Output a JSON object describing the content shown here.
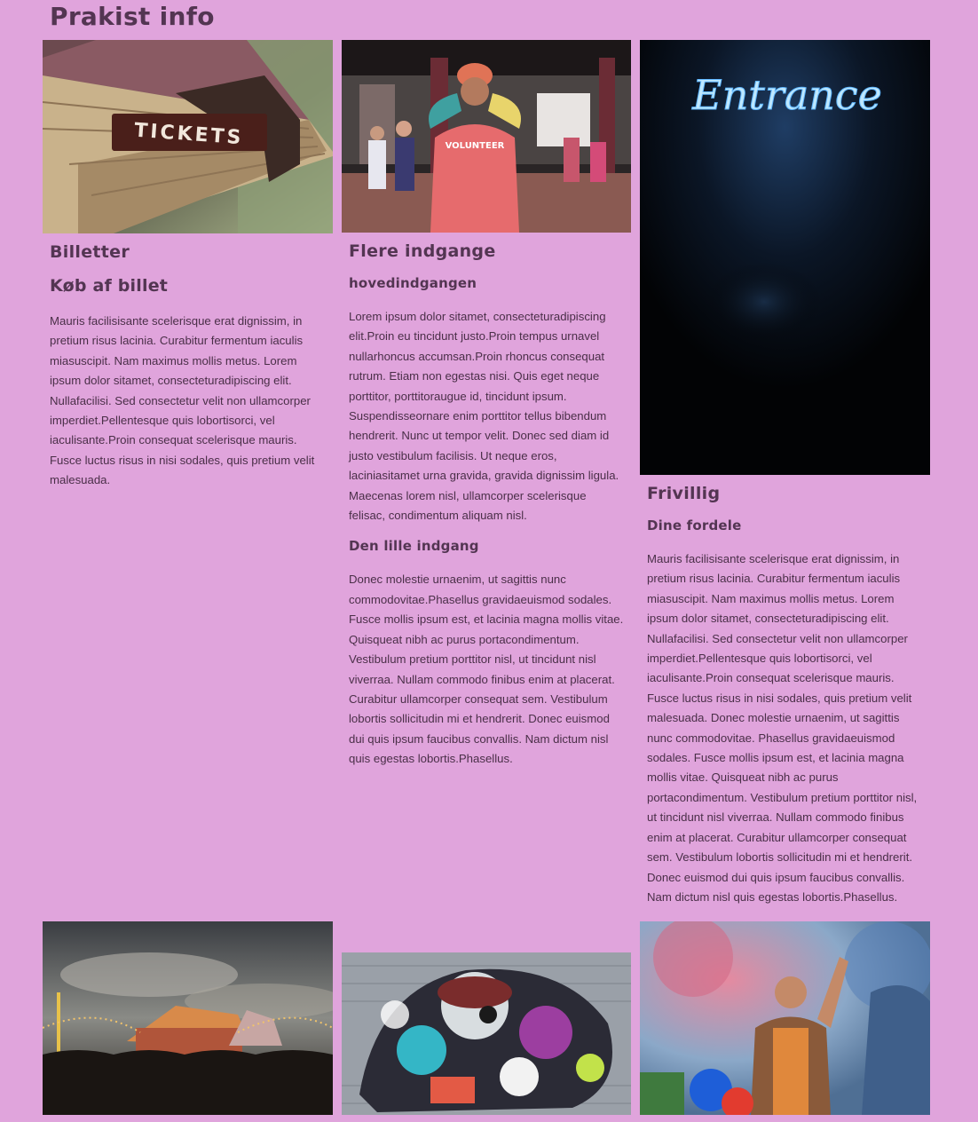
{
  "page": {
    "title": "Prakist info"
  },
  "columns": [
    {
      "image_alt": "tickets-sign-photo",
      "heading": "Billetter",
      "subheading": "Køb af billet",
      "body": "Mauris facilisisante scelerisque erat dignissim, in pretium risus lacinia. Curabitur fermentum iaculis miasuscipit. Nam maximus mollis metus. Lorem ipsum dolor sitamet, consecteturadipiscing elit. Nullafacilisi. Sed consectetur velit non ullamcorper imperdiet.Pellentesque quis lobortisorci, vel iaculisante.Proin consequat scelerisque mauris. Fusce luctus risus in nisi sodales, quis pretium velit malesuada."
    },
    {
      "image_alt": "volunteer-photo",
      "heading": "Flere indgange",
      "subheading": "hovedindgangen",
      "body": "Lorem ipsum dolor sitamet, consecteturadipiscing elit.Proin eu tincidunt justo.Proin tempus urnavel nullarhoncus accumsan.Proin rhoncus consequat rutrum. Etiam non egestas nisi. Quis eget neque porttitor, porttitoraugue id, tincidunt ipsum. Suspendisseornare enim porttitor tellus bibendum hendrerit. Nunc ut tempor velit. Donec sed diam id justo vestibulum facilisis. Ut neque eros, laciniasitamet urna gravida, gravida dignissim ligula. Maecenas lorem nisl, ullamcorper scelerisque felisac, condimentum aliquam nisl.",
      "subheading2": "Den lille indgang",
      "body2": "Donec molestie urnaenim, ut sagittis nunc commodovitae.Phasellus gravidaeuismod sodales. Fusce mollis ipsum est, et lacinia magna mollis vitae. Quisqueat nibh ac purus portacondimentum. Vestibulum pretium porttitor nisl, ut tincidunt nisl viverraa. Nullam commodo finibus enim at placerat. Curabitur ullamcorper consequat sem. Vestibulum lobortis sollicitudin mi et hendrerit. Donec euismod dui quis ipsum faucibus convallis. Nam dictum nisl quis egestas lobortis.Phasellus."
    },
    {
      "image_alt": "entrance-neon-photo",
      "neon_text": "Entrance",
      "heading": "Frivillig",
      "subheading": "Dine fordele",
      "body": "Mauris facilisisante scelerisque erat dignissim, in pretium risus lacinia. Curabitur fermentum iaculis miasuscipit. Nam maximus mollis metus. Lorem ipsum dolor sitamet, consecteturadipiscing elit. Nullafacilisi. Sed consectetur velit non ullamcorper imperdiet.Pellentesque quis lobortisorci, vel iaculisante.Proin consequat scelerisque mauris. Fusce luctus risus in nisi sodales, quis pretium velit malesuada. Donec molestie urnaenim, ut sagittis nunc commodovitae. Phasellus gravidaeuismod sodales. Fusce mollis ipsum est, et lacinia magna mollis vitae. Quisqueat nibh ac purus portacondimentum. Vestibulum pretium porttitor nisl, ut tincidunt nisl viverraa. Nullam commodo finibus enim at placerat. Curabitur ullamcorper consequat sem. Vestibulum lobortis sollicitudin mi et hendrerit. Donec euismod dui quis ipsum faucibus convallis. Nam dictum nisl quis egestas lobortis.Phasellus."
    }
  ],
  "signs": {
    "tickets": "TICKETS",
    "volunteer": "VOLUNTEER"
  },
  "colors": {
    "background": "#e0a4dc",
    "heading": "#533552",
    "text": "#4a2f48"
  }
}
